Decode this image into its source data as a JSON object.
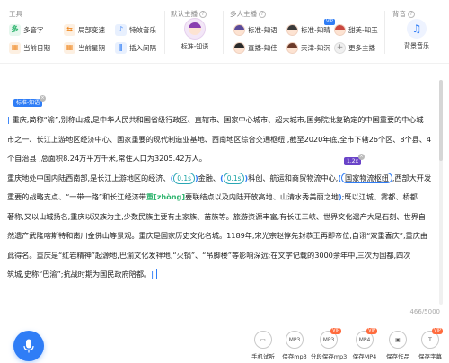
{
  "toolbar": {
    "tools_label": "工具",
    "tools": [
      {
        "label": "多音字",
        "icon": "polyphone-icon"
      },
      {
        "label": "局部变速",
        "icon": "speed-icon"
      },
      {
        "label": "特效音乐",
        "icon": "music-effect-icon"
      },
      {
        "label": "当前日期",
        "icon": "date-icon"
      },
      {
        "label": "当前星期",
        "icon": "week-icon"
      },
      {
        "label": "插入间隔",
        "icon": "pause-icon"
      }
    ],
    "main_anchor_label": "默认主播",
    "main_anchor_name": "标准-知语",
    "multi_anchor_label": "多人主播",
    "multi_anchors": [
      {
        "name": "标准-知语"
      },
      {
        "name": "标准-知晴"
      },
      {
        "name": "甜美-知玉"
      },
      {
        "name": "直播-知佳"
      },
      {
        "name": "天津-知沉"
      },
      {
        "name": "更多主播"
      }
    ],
    "bgm_label": "背音",
    "bgm_name": "背景音乐"
  },
  "editor": {
    "speaker_tag": "标准-知语",
    "speed_tag": "1.2x",
    "pause_1": "0.1s",
    "pause_2": "0.1s",
    "pinyin": "[zhòng]",
    "line1": "重庆,简称“渝”,别称山城,是中华人民共和国省级行政区、直辖市、国家中心城市、超大城市,国务院批复确定的中国重要的中心城",
    "line2": "市之一、长江上游地区经济中心、国家重要的现代制造业基地、西南地区综合交通枢纽 ,截至2020年底,全市下辖26个区、8个县、4",
    "line3": "个自治县 ,总面积8.24万平方千米,常住人口为3205.42万人。",
    "line4a": "重庆地处中国内陆西南部,是长江上游地区的经济、",
    "line4b": "金融、",
    "line4c": "科创、航运和商贸物流中心,",
    "line4d": "国家物流枢纽",
    "line4e": ",西部大开发",
    "line5a": "重要的战略支点、“一带一路”和长江经济带",
    "line5b": "要联结点以及内陆开放高地、山清水秀美丽之地",
    "line5c": ";既以江城、雾都、桥都",
    "line6": "著称,又以山城扬名,重庆以汉族为主,少数民族主要有土家族、苗族等。旅游资源丰富,有长江三峡、世界文化遗产大足石刻、世界自",
    "line7": "然遗产武隆喀斯特和南川金佛山等景观。重庆是国家历史文化名城。1189年,宋光宗赵惇先封恭王再即帝位,自诩“双重喜庆”,重庆由",
    "line8": "此得名。重庆是“红岩精神”起源地,巴渝文化发祥地,“火锅”、“吊脚楼”等影响深远;在文字记载的3000余年中,三次为国都,四次",
    "line9": "筑城,史称“巴渝”;抗战时期为国民政府陪都。",
    "char_count": "466/5000"
  },
  "actions": [
    {
      "label": "手机试听",
      "icon": "phone-preview-icon",
      "glyph": "▭",
      "vip": ""
    },
    {
      "label": "保存mp3",
      "icon": "save-mp3-icon",
      "glyph": "MP3",
      "vip": ""
    },
    {
      "label": "分段保存mp3",
      "icon": "split-save-mp3-icon",
      "glyph": "MP3",
      "vip": "VIP"
    },
    {
      "label": "保存MP4",
      "icon": "save-mp4-icon",
      "glyph": "MP4",
      "vip": "VIP"
    },
    {
      "label": "保存作品",
      "icon": "save-work-icon",
      "glyph": "▣",
      "vip": ""
    },
    {
      "label": "保存字幕",
      "icon": "save-subtitle-icon",
      "glyph": "T",
      "vip": "VIP"
    }
  ],
  "colors": {
    "accent": "#2f7df6",
    "pause": "#17a2a2",
    "pinyin": "#2fb46e",
    "speed": "#6a44c8"
  }
}
